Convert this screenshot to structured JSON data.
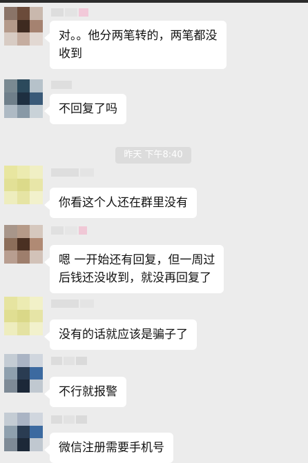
{
  "chat": {
    "messages": [
      {
        "text": "对。。他分两笔转的，两笔都没收到",
        "line1": "对。。他分两笔转的，两笔都没",
        "line2": "收到"
      },
      {
        "text": "不回复了吗"
      },
      {
        "text": "你看这个人还在群里没有"
      },
      {
        "text": "嗯 一开始还有回复，但一周过后钱还没收到，就没再回复了",
        "line1": "嗯 一开始还有回复，但一周过",
        "line2": "后钱还没收到，就没再回复了"
      },
      {
        "text": "没有的话就应该是骗子了"
      },
      {
        "text": "不行就报警"
      },
      {
        "text": "微信注册需要手机号"
      }
    ],
    "timestamp": "昨天 下午8:40"
  },
  "colors": {
    "background": "#ececec",
    "bubble": "#ffffff",
    "timestamp_pill": "#dcdcdc",
    "text": "#111111"
  }
}
